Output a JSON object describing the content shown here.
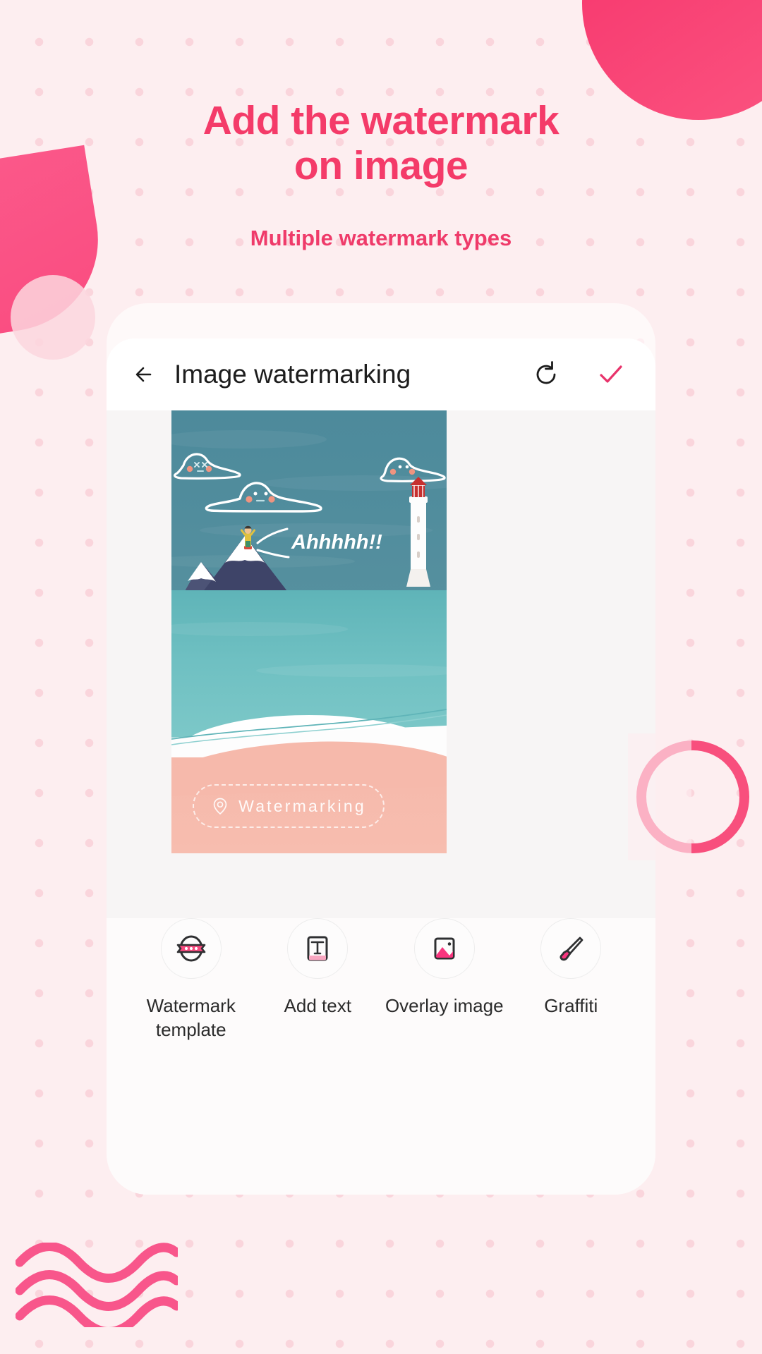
{
  "theme": {
    "accent": "#f43b69",
    "accent_dark": "#ef3b6a",
    "bg": "#fdeef0",
    "dot": "#f9cdd5",
    "check": "#e8336b"
  },
  "headline": "Add the watermark\non image",
  "headline_line1": "Add the watermark",
  "headline_line2": "on image",
  "subhead": "Multiple watermark types",
  "app": {
    "appbar": {
      "back_icon": "arrow-left-icon",
      "title": "Image watermarking",
      "refresh_icon": "refresh-icon",
      "confirm_icon": "check-icon"
    },
    "photo": {
      "speech_text": "Ahhhhh!!!",
      "alt": "Illustration of a person shouting on a snowy mountain beside the sea with a lighthouse and cute clouds"
    },
    "watermark": {
      "icon": "location-pin-icon",
      "text": "Watermarking"
    },
    "tools": [
      {
        "icon": "watermark-template-icon",
        "label": "Watermark\ntemplate",
        "label_line1": "Watermark",
        "label_line2": "template"
      },
      {
        "icon": "add-text-icon",
        "label": "Add text",
        "label_line1": "Add text",
        "label_line2": ""
      },
      {
        "icon": "overlay-image-icon",
        "label": "Overlay image",
        "label_line1": "Overlay image",
        "label_line2": ""
      },
      {
        "icon": "graffiti-brush-icon",
        "label": "Graffiti",
        "label_line1": "Graffiti",
        "label_line2": ""
      }
    ]
  },
  "decorations": {
    "circle_top_right": "pink-circle",
    "ribbon_left": "pink-ribbon",
    "ring_right": "pink-ring",
    "waves_bottom_left": "pink-waves"
  }
}
